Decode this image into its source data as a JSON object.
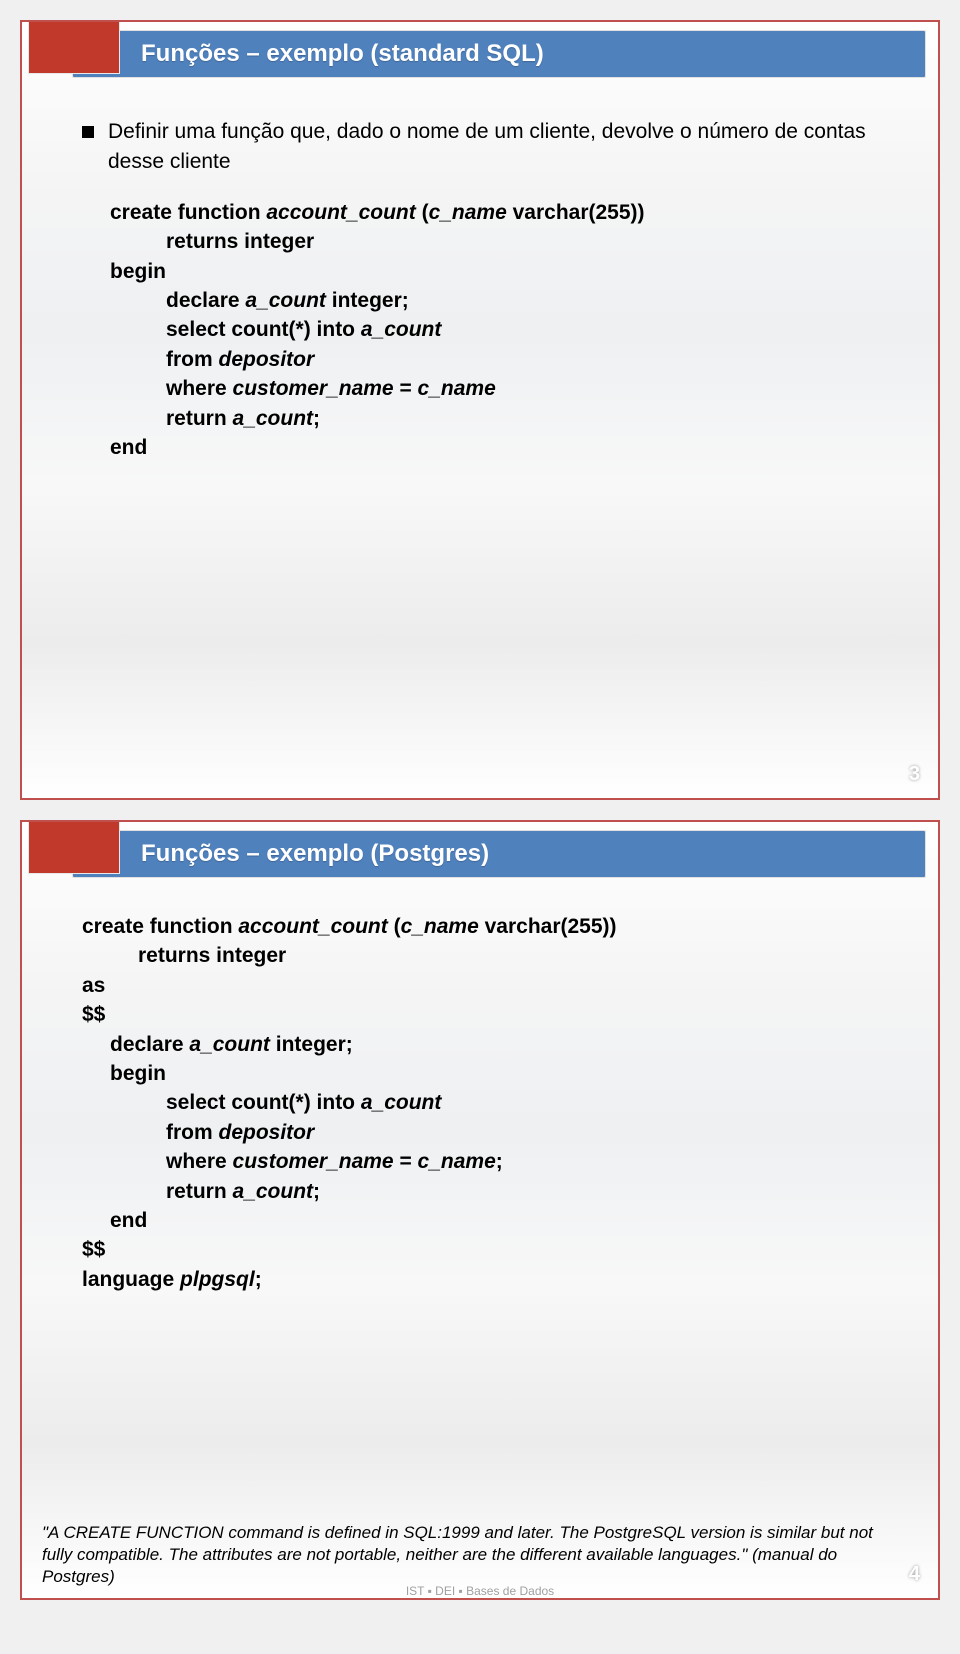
{
  "slide1": {
    "title": "Funções – exemplo (standard SQL)",
    "bullet": "Definir uma função que, dado o nome de um cliente, devolve o número de contas desse cliente",
    "code": {
      "l1a": "create function ",
      "l1b": "account_count ",
      "l1c": "(",
      "l1d": "c_name ",
      "l1e": "varchar(255))",
      "l2": "returns integer",
      "l3": "begin",
      "l4a": "declare ",
      "l4b": "a_count ",
      "l4c": "integer;",
      "l5a": "select count(*) into ",
      "l5b": "a_count",
      "l6a": "from ",
      "l6b": "depositor",
      "l7a": "where ",
      "l7b": "customer_name ",
      "l7c": "= ",
      "l7d": "c_name",
      "l8a": "return ",
      "l8b": "a_count",
      "l8c": ";",
      "l9": "end"
    },
    "page": "3"
  },
  "slide2": {
    "title": "Funções – exemplo (Postgres)",
    "code": {
      "l1a": "create function ",
      "l1b": "account_count ",
      "l1c": "(",
      "l1d": "c_name ",
      "l1e": "varchar(255))",
      "l2": "returns integer",
      "l3": "as",
      "l4": "$$",
      "l5a": "declare ",
      "l5b": "a_count  ",
      "l5c": "integer;",
      "l6": "begin",
      "l7a": "select count(*) into ",
      "l7b": "a_count",
      "l8a": "from ",
      "l8b": "depositor",
      "l9a": "where ",
      "l9b": "customer_name ",
      "l9c": "= ",
      "l9d": "c_name",
      "l9e": ";",
      "l10a": "return ",
      "l10b": "a_count",
      "l10c": ";",
      "l11": "end",
      "l12": "$$",
      "l13a": "language ",
      "l13b": "plpgsql",
      "l13c": ";"
    },
    "footnote": "\"A CREATE FUNCTION command is defined in SQL:1999 and later. The PostgreSQL version is similar but not fully compatible. The attributes are not portable, neither are the different available languages.\" (manual do Postgres)",
    "footer": "IST ▪ DEI ▪ Bases de Dados",
    "page": "4"
  }
}
